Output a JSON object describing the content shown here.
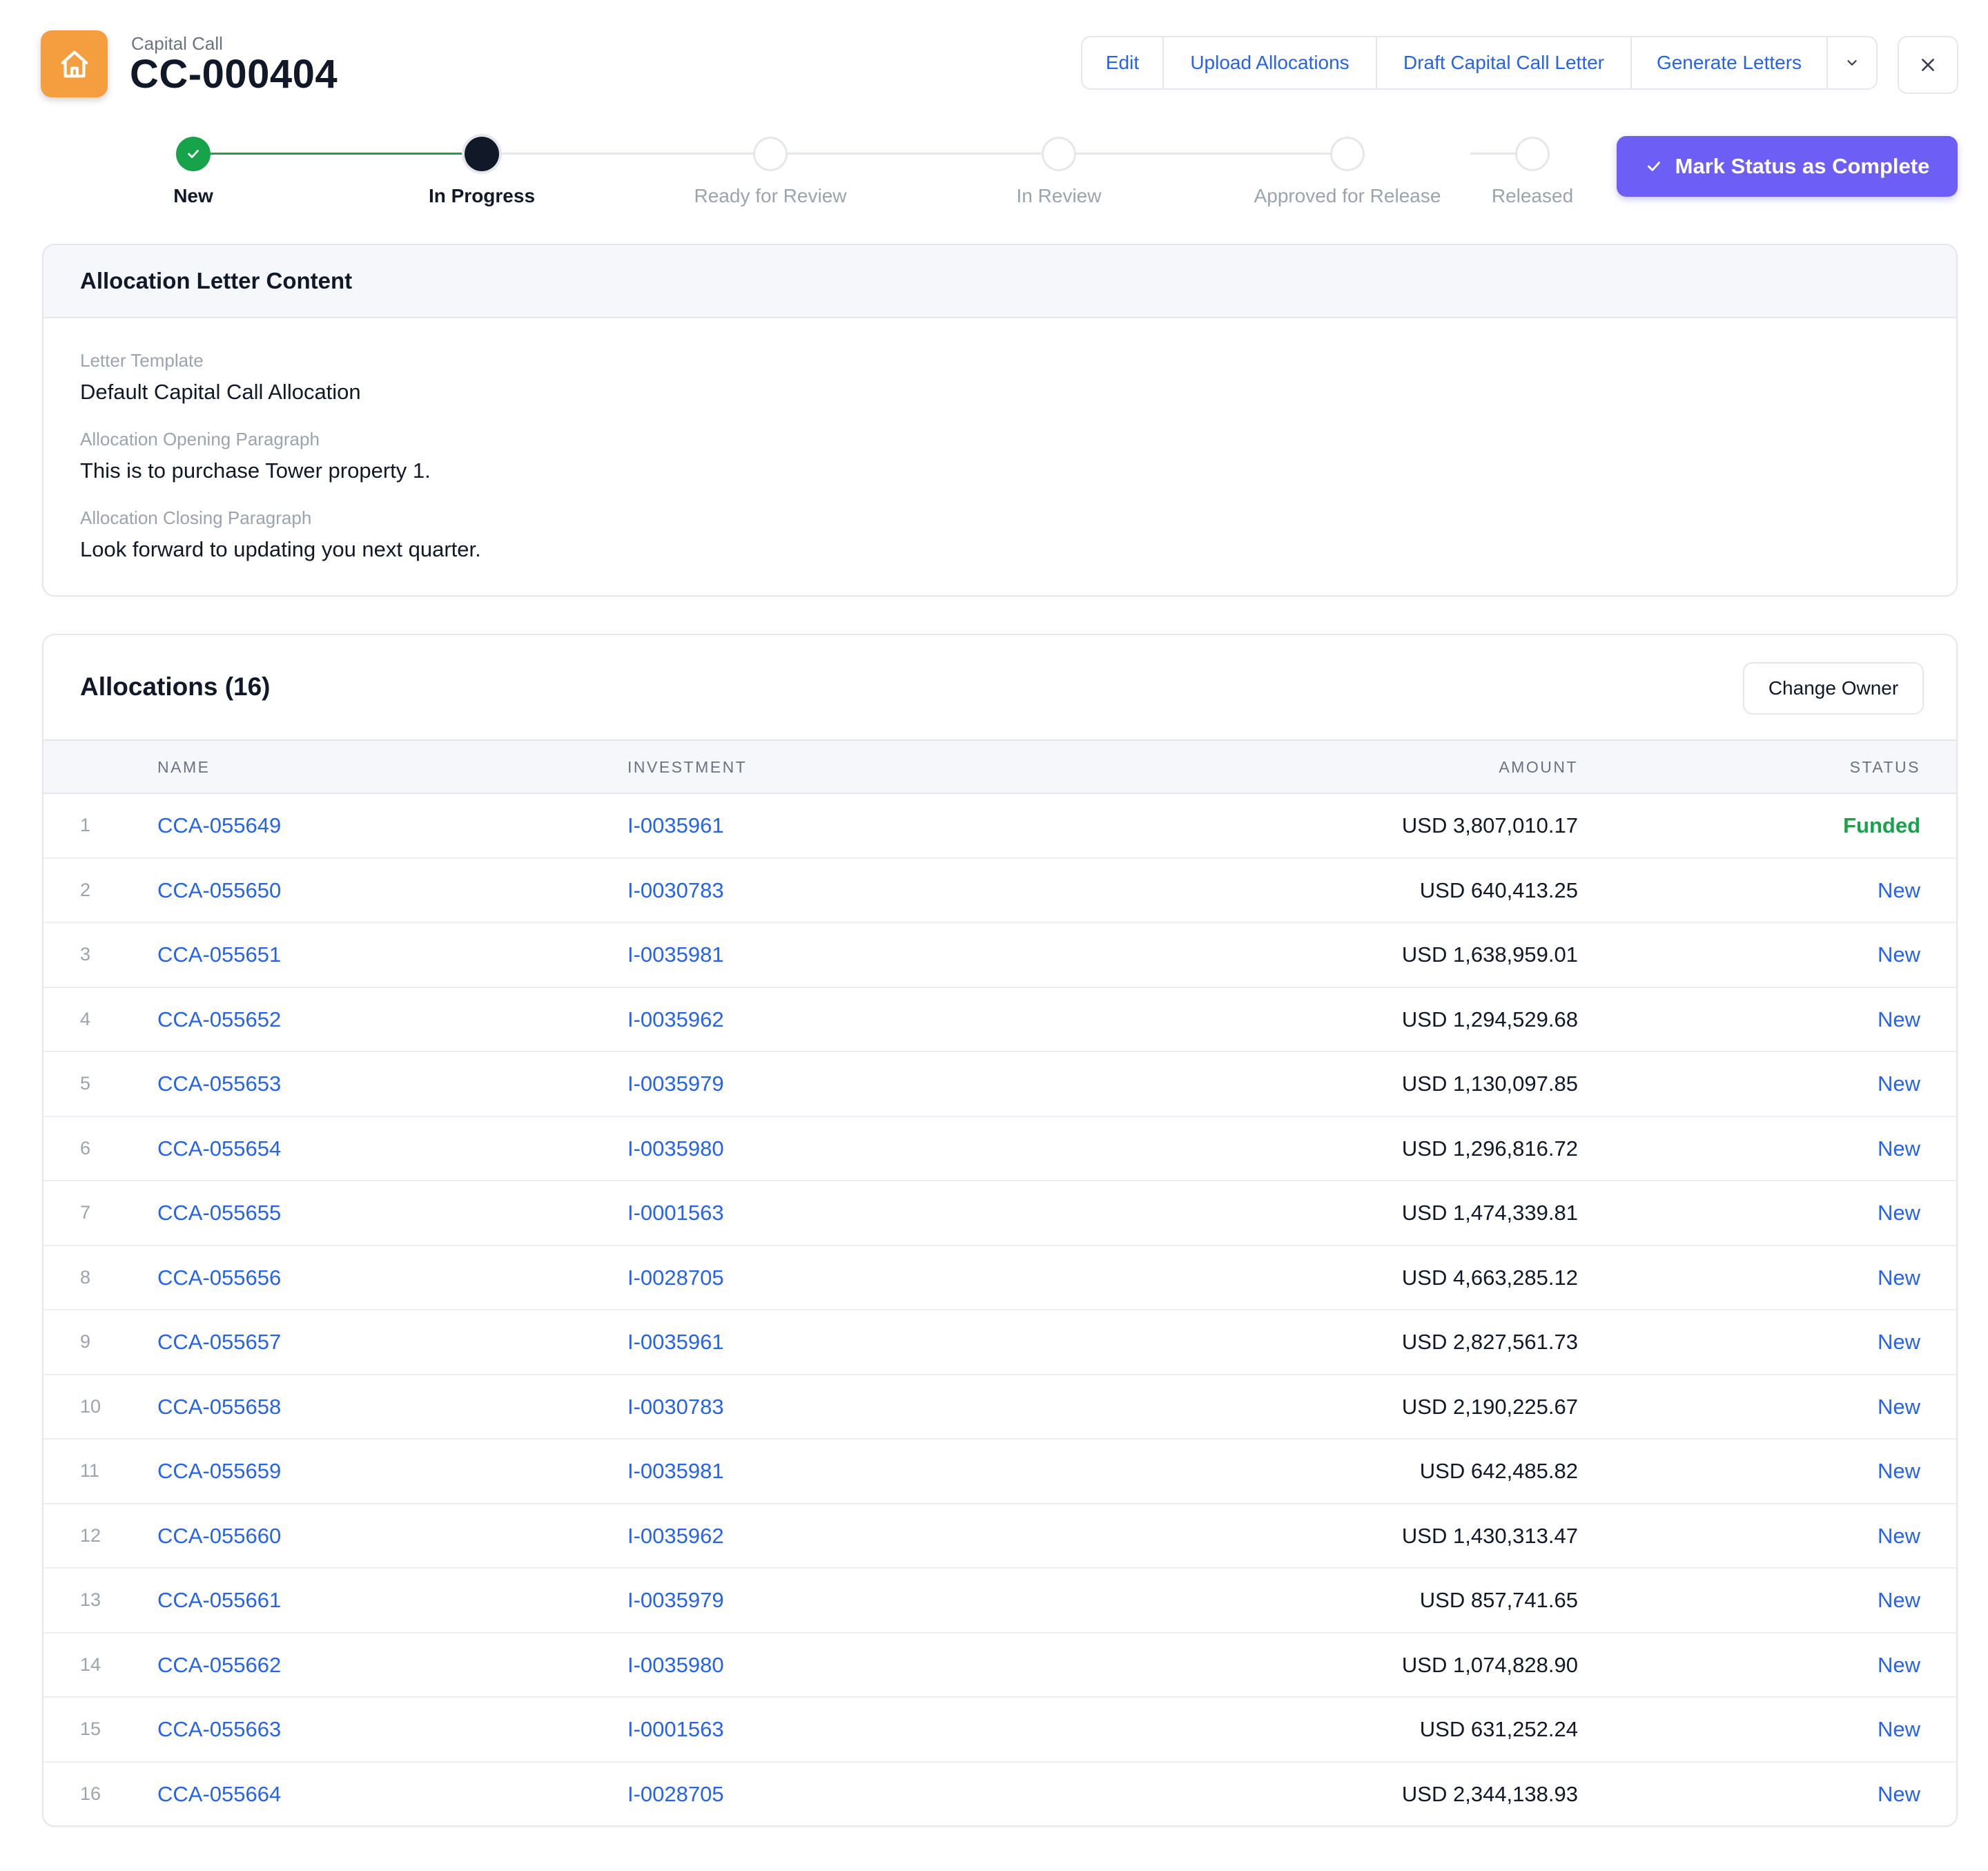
{
  "header": {
    "subtitle": "Capital Call",
    "title": "CC-000404",
    "actions": {
      "edit": "Edit",
      "upload": "Upload Allocations",
      "draft": "Draft Capital Call Letter",
      "generate": "Generate Letters"
    },
    "icons": {
      "home": "home-icon",
      "dropdown": "chevron-down-icon",
      "close": "close-icon"
    }
  },
  "stepper": {
    "steps": [
      "New",
      "In Progress",
      "Ready for Review",
      "In Review",
      "Approved for Release",
      "Released"
    ],
    "current_index": 1,
    "mark_complete_label": "Mark Status as Complete"
  },
  "letter": {
    "heading": "Allocation Letter Content",
    "template_label": "Letter Template",
    "template_value": "Default Capital Call Allocation",
    "opening_label": "Allocation Opening Paragraph",
    "opening_value": "This is to purchase Tower property 1.",
    "closing_label": "Allocation Closing Paragraph",
    "closing_value": "Look forward to updating you next quarter."
  },
  "allocations": {
    "title": "Allocations (16)",
    "change_owner_label": "Change Owner",
    "columns": {
      "name": "NAME",
      "investment": "INVESTMENT",
      "amount": "AMOUNT",
      "status": "STATUS"
    },
    "rows": [
      {
        "num": "1",
        "name": "CCA-055649",
        "investment": "I-0035961",
        "amount": "USD 3,807,010.17",
        "status": "Funded"
      },
      {
        "num": "2",
        "name": "CCA-055650",
        "investment": "I-0030783",
        "amount": "USD 640,413.25",
        "status": "New"
      },
      {
        "num": "3",
        "name": "CCA-055651",
        "investment": "I-0035981",
        "amount": "USD 1,638,959.01",
        "status": "New"
      },
      {
        "num": "4",
        "name": "CCA-055652",
        "investment": "I-0035962",
        "amount": "USD 1,294,529.68",
        "status": "New"
      },
      {
        "num": "5",
        "name": "CCA-055653",
        "investment": "I-0035979",
        "amount": "USD 1,130,097.85",
        "status": "New"
      },
      {
        "num": "6",
        "name": "CCA-055654",
        "investment": "I-0035980",
        "amount": "USD 1,296,816.72",
        "status": "New"
      },
      {
        "num": "7",
        "name": "CCA-055655",
        "investment": "I-0001563",
        "amount": "USD 1,474,339.81",
        "status": "New"
      },
      {
        "num": "8",
        "name": "CCA-055656",
        "investment": "I-0028705",
        "amount": "USD 4,663,285.12",
        "status": "New"
      },
      {
        "num": "9",
        "name": "CCA-055657",
        "investment": "I-0035961",
        "amount": "USD 2,827,561.73",
        "status": "New"
      },
      {
        "num": "10",
        "name": "CCA-055658",
        "investment": "I-0030783",
        "amount": "USD 2,190,225.67",
        "status": "New"
      },
      {
        "num": "11",
        "name": "CCA-055659",
        "investment": "I-0035981",
        "amount": "USD 642,485.82",
        "status": "New"
      },
      {
        "num": "12",
        "name": "CCA-055660",
        "investment": "I-0035962",
        "amount": "USD 1,430,313.47",
        "status": "New"
      },
      {
        "num": "13",
        "name": "CCA-055661",
        "investment": "I-0035979",
        "amount": "USD 857,741.65",
        "status": "New"
      },
      {
        "num": "14",
        "name": "CCA-055662",
        "investment": "I-0035980",
        "amount": "USD 1,074,828.90",
        "status": "New"
      },
      {
        "num": "15",
        "name": "CCA-055663",
        "investment": "I-0001563",
        "amount": "USD 631,252.24",
        "status": "New"
      },
      {
        "num": "16",
        "name": "CCA-055664",
        "investment": "I-0028705",
        "amount": "USD 2,344,138.93",
        "status": "New"
      }
    ]
  },
  "colors": {
    "accent": "#6d5ef5",
    "link": "#2563eb",
    "success": "#16a34a",
    "home_tile": "#f59e3f"
  }
}
